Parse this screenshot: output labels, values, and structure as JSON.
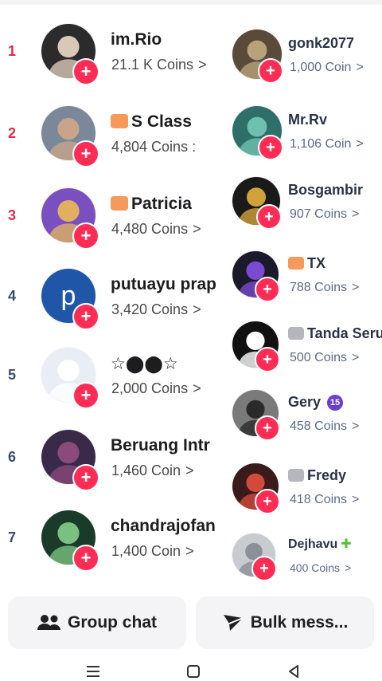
{
  "colors": {
    "rank_red": "#e3294d",
    "rank_blue": "#3b4b70",
    "plus": "#ff2d55"
  },
  "left_list": [
    {
      "rank": "1",
      "name": "im.Rio",
      "coins": "21.1 K Coins",
      "chevron": ">",
      "badge": ""
    },
    {
      "rank": "2",
      "name": "S Class",
      "coins": "4,804 Coins :",
      "chevron": "",
      "badge": "shield-badge"
    },
    {
      "rank": "3",
      "name": "Patricia",
      "coins": "4,480 Coins",
      "chevron": ">",
      "badge": "shield-badge"
    },
    {
      "rank": "4",
      "name": "putuayu prap",
      "coins": "3,420 Coins",
      "chevron": ">",
      "badge": "",
      "avatar_letter": "p"
    },
    {
      "rank": "5",
      "name": "☆⬤⬤☆",
      "coins": "2,000 Coins",
      "chevron": ">",
      "badge": ""
    },
    {
      "rank": "6",
      "name": "Beruang Intr",
      "coins": "1,460 Coin",
      "chevron": ">",
      "badge": ""
    },
    {
      "rank": "7",
      "name": "chandrajofan",
      "coins": "1,400 Coin",
      "chevron": ">",
      "badge": ""
    }
  ],
  "right_list": [
    {
      "name": "gonk2077",
      "coins": "1,000 Coin",
      "chevron": ">"
    },
    {
      "name": "Mr.Rv",
      "coins": "1,106 Coin",
      "chevron": ">"
    },
    {
      "name": "Bosgambir",
      "coins": "907 Coins",
      "chevron": ">"
    },
    {
      "name": "TX",
      "coins": "788 Coins",
      "chevron": ">"
    },
    {
      "name": "Tanda Seru",
      "coins": "500 Coins",
      "chevron": ">"
    },
    {
      "name": "Gery",
      "coins": "458 Coins",
      "chevron": ">",
      "level": "15"
    },
    {
      "name": "Fredy",
      "coins": "418 Coins",
      "chevron": ">"
    },
    {
      "name": "Dejhavu",
      "coins": "400 Coins",
      "chevron": ">"
    }
  ],
  "buttons": {
    "group_chat": "Group chat",
    "bulk_message": "Bulk mess..."
  },
  "navbar": {
    "recent_icon": "≡",
    "home_icon": "▢",
    "back_icon": "◁"
  }
}
